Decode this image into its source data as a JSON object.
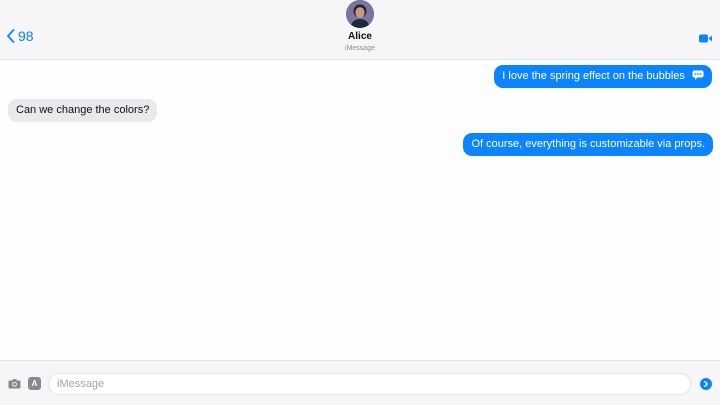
{
  "header": {
    "back_label": "98",
    "contact_name": "Alice",
    "service": "iMessage",
    "accent_color": "#0b84fe"
  },
  "icons": {
    "back": "chevron-left-icon",
    "video": "video-camera-icon",
    "camera": "camera-icon",
    "apps": "app-store-icon",
    "send": "send-arrow-icon",
    "emoji": "speech-bubble-emoji"
  },
  "apps_icon_letter": "A",
  "messages": [
    {
      "direction": "outgoing",
      "text": "I love the spring effect on the bubbles",
      "has_emoji": true
    },
    {
      "direction": "incoming",
      "text": "Can we change the colors?"
    },
    {
      "direction": "outgoing",
      "text": "Of course, everything is customizable via props."
    }
  ],
  "composer": {
    "placeholder": "iMessage",
    "value": ""
  },
  "colors": {
    "outgoing_bubble": "#0b84fe",
    "incoming_bubble": "#e9e8ed",
    "background": "#fefdfe"
  }
}
